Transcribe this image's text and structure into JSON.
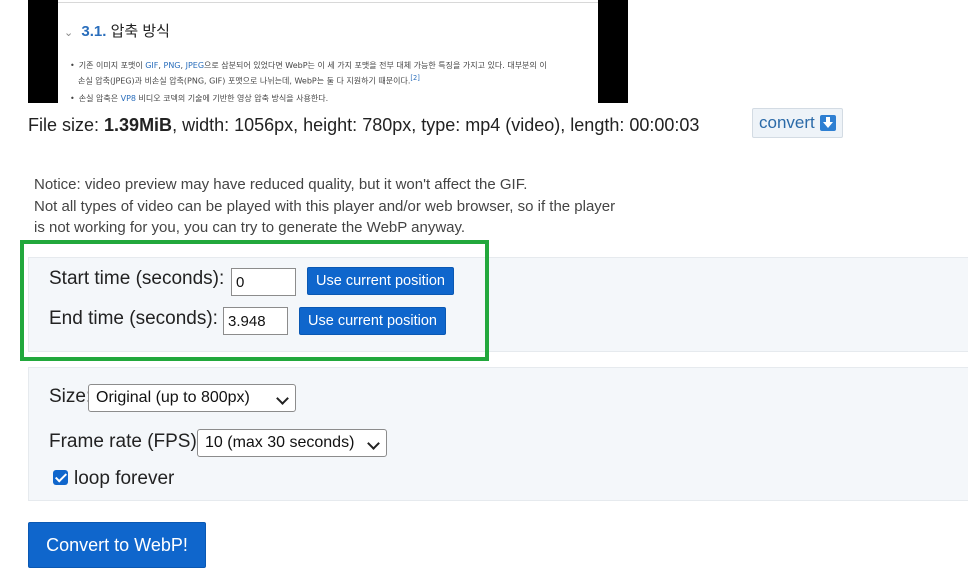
{
  "preview": {
    "heading_number": "3.1.",
    "heading_text": "압축 방식",
    "line1_a": "기존 이미지 포맷이 ",
    "line1_links": [
      "GIF",
      "PNG",
      "JPEG"
    ],
    "line1_b": "으로 삼분되어 있었다면 WebP는 이 세 가지 포맷을 전부 대체 가능한 특징을 가지고 있다. 대부분의 이",
    "line2": "손실 압축(JPEG)과 비손실 압축(PNG, GIF) 포맷으로 나뉘는데, WebP는 둘 다 지원하기 때문이다.",
    "line2_ref": "[2]",
    "line3_a": "손실 압축은 ",
    "line3_link": "VP8",
    "line3_b": " 비디오 코덱의 기술에 기반한 영상 압축 방식을 사용한다."
  },
  "file_info": {
    "label": "File size: ",
    "size": "1.39MiB",
    "rest": ", width: 1056px, height: 780px, type: mp4 (video), length: 00:00:03"
  },
  "convert_link": {
    "label": "convert",
    "icon": "download-icon"
  },
  "notice": {
    "line1": "Notice: video preview may have reduced quality, but it won't affect the GIF.",
    "line2": "Not all types of video can be played with this player and/or web browser, so if the player",
    "line3": "is not working for you, you can try to generate the WebP anyway."
  },
  "time": {
    "start_label": "Start time (seconds):",
    "start_value": "0",
    "end_label": "End time (seconds):",
    "end_value": "3.948",
    "use_current_label": "Use current position"
  },
  "options": {
    "size_label": "Size:",
    "size_selected": "Original (up to 800px)",
    "fps_label": "Frame rate (FPS):",
    "fps_selected": "10 (max 30 seconds)",
    "loop_label": "loop forever",
    "loop_checked": true
  },
  "submit_label": "Convert to WebP!",
  "colors": {
    "accent": "#0f66cc",
    "highlight": "#22a83c",
    "panel_bg": "#f4f7fa",
    "link": "#2b6aa8"
  }
}
